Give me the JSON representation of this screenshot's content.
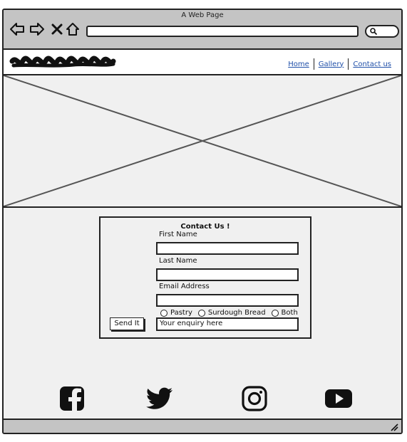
{
  "window": {
    "title": "A Web Page"
  },
  "nav": {
    "links": [
      {
        "label": "Home"
      },
      {
        "label": "Gallery"
      },
      {
        "label": "Contact us"
      }
    ]
  },
  "form": {
    "title": "Contact Us !",
    "fields": [
      {
        "label": "First Name",
        "value": ""
      },
      {
        "label": "Last Name",
        "value": ""
      },
      {
        "label": "Email Address",
        "value": ""
      }
    ],
    "options": [
      "Pastry",
      "Surdough Bread",
      "Both"
    ],
    "submit_label": "Send It",
    "enquiry_placeholder": "Your enquiry here"
  },
  "social": {
    "icons": [
      "facebook-icon",
      "twitter-icon",
      "instagram-icon",
      "youtube-icon"
    ]
  },
  "colors": {
    "link": "#1f4fa8",
    "chrome": "#c4c4c4",
    "border": "#222222"
  }
}
